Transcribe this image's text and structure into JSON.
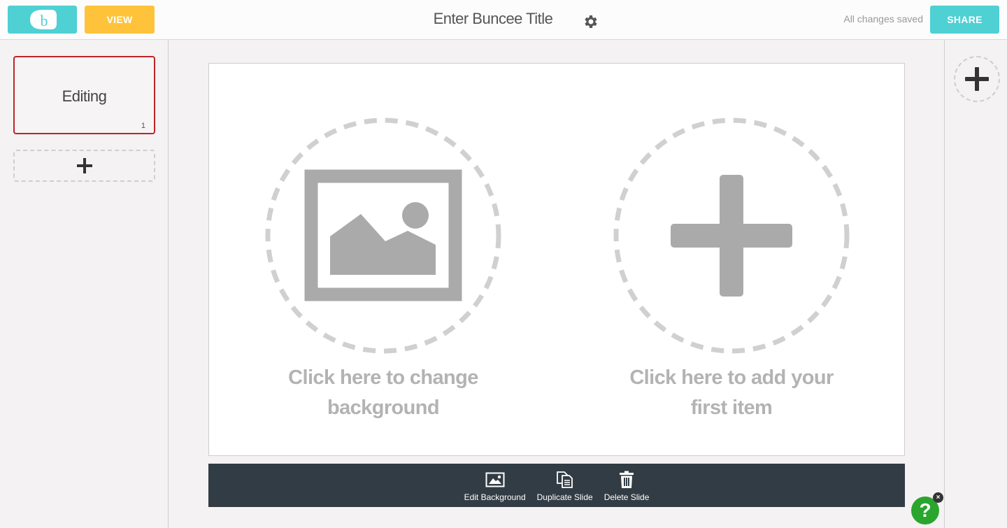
{
  "header": {
    "view_label": "VIEW",
    "title": "Enter Buncee Title",
    "status": "All changes saved",
    "share_label": "SHARE",
    "logo_icon": "buncee-logo-icon",
    "settings_icon": "gear-icon"
  },
  "sidebar": {
    "slides": [
      {
        "label": "Editing",
        "number": "1"
      }
    ],
    "add_slide_icon": "plus-icon"
  },
  "canvas": {
    "background_prompt": [
      "Click here to change",
      "background"
    ],
    "item_prompt": [
      "Click here to add your",
      "first item"
    ],
    "background_icon": "image-icon",
    "item_icon": "plus-icon"
  },
  "toolbar": {
    "items": [
      {
        "label": "Edit Background",
        "icon": "image-icon"
      },
      {
        "label": "Duplicate Slide",
        "icon": "duplicate-icon"
      },
      {
        "label": "Delete Slide",
        "icon": "trash-icon"
      }
    ]
  },
  "rightbar": {
    "add_icon": "plus-icon"
  },
  "help": {
    "label": "?",
    "close_label": "×"
  },
  "colors": {
    "teal": "#4fd0d3",
    "yellow": "#fec33a",
    "active_border": "#c0222c",
    "toolbar_bg": "#323c44",
    "help_green": "#2aa52d",
    "placeholder_gray": "#aaaaaa"
  }
}
